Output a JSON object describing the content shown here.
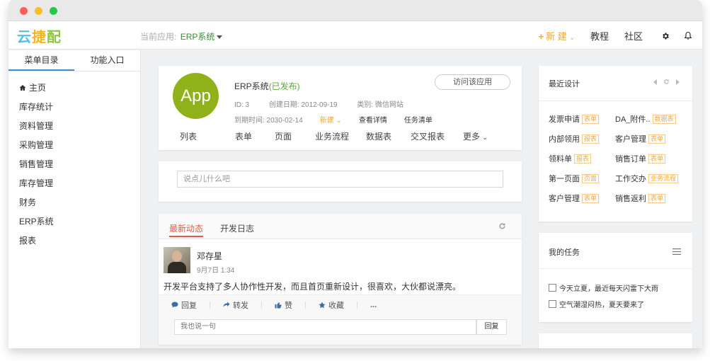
{
  "header": {
    "logo": [
      "云",
      "捷",
      "配"
    ],
    "current_app_label": "当前应用:",
    "current_app_name": "ERP系统",
    "new_label": "新 建",
    "tutorial": "教程",
    "community": "社区"
  },
  "sidebar": {
    "tabs": [
      {
        "label": "菜单目录"
      },
      {
        "label": "功能入口"
      }
    ],
    "items": [
      {
        "label": "主页"
      },
      {
        "label": "库存统计"
      },
      {
        "label": "资料管理"
      },
      {
        "label": "采购管理"
      },
      {
        "label": "销售管理"
      },
      {
        "label": "库存管理"
      },
      {
        "label": "财务"
      },
      {
        "label": "ERP系统"
      },
      {
        "label": "报表"
      }
    ]
  },
  "app_card": {
    "logo_text": "App",
    "name": "ERP系统",
    "status": "(已发布)",
    "visit_button": "访问该应用",
    "id": "ID: 3",
    "created": "创建日期: 2012-09-19",
    "category": "类别: 微信网站",
    "expires": "到期时间: 2030-02-14",
    "new_link": "新建",
    "details_link": "查看详情",
    "tasks_link": "任务清单",
    "nav": [
      "列表",
      "表单",
      "页面",
      "业务流程",
      "数据表",
      "交叉报表",
      "更多"
    ]
  },
  "composer": {
    "placeholder": "说点儿什么吧"
  },
  "feed": {
    "tabs": [
      "最新动态",
      "开发日志"
    ],
    "post": {
      "author": "邓存星",
      "time": "9月7日 1:34",
      "text": "开发平台支持了多人协作性开发，而且首页重新设计，很喜欢，大伙都说漂亮。"
    },
    "actions": [
      "回复",
      "转发",
      "赞",
      "收藏",
      "..."
    ],
    "reply_placeholder": "我也说一句",
    "reply_button": "回复"
  },
  "recent_designs": {
    "title": "最近设计",
    "items": [
      {
        "name": "发票申请",
        "tag": "表单"
      },
      {
        "name": "DA_附件..",
        "tag": "数据表"
      },
      {
        "name": "内部领用",
        "tag": "报表"
      },
      {
        "name": "客户管理",
        "tag": "表单"
      },
      {
        "name": "领料单",
        "tag": "报表"
      },
      {
        "name": "销售订单",
        "tag": "表单"
      },
      {
        "name": "第一页面",
        "tag": "页面"
      },
      {
        "name": "工作交办",
        "tag": "业务流程"
      },
      {
        "name": "客户管理",
        "tag": "表单"
      },
      {
        "name": "销售返利",
        "tag": "表单"
      }
    ]
  },
  "my_tasks": {
    "title": "我的任务",
    "items": [
      {
        "label": "今天立夏，最近每天闪雷下大雨",
        "checked": false
      },
      {
        "label": "空气潮湿闷热，夏天要来了",
        "checked": false
      }
    ]
  },
  "colors": {
    "accent_orange": "#f5a623",
    "brand_green": "#8fb21a",
    "active_red": "#e05a4a",
    "tab_blue": "#3a8ec4"
  }
}
